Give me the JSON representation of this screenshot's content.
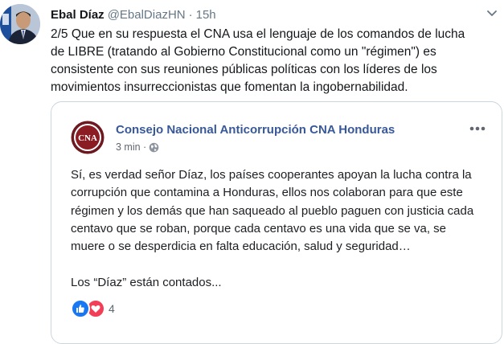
{
  "tweet": {
    "author_name": "Ebal Díaz",
    "author_handle": "@EbalDiazHN",
    "separator": "·",
    "timestamp": "15h",
    "text": "2/5 Que en su respuesta el CNA usa el lenguaje de los comandos de lucha\nde LIBRE (tratando al Gobierno Constitucional como un \"régimen\") es\nconsistente con sus reuniones públicas políticas con los líderes de los\nmovimientos insurreccionistas que fomentan la ingobernabilidad."
  },
  "facebook_post": {
    "page_name": "Consejo Nacional Anticorrupción CNA Honduras",
    "logo_text": "CNA",
    "time": "3 min ·",
    "body": "Sí, es verdad señor Díaz, los países cooperantes apoyan la lucha contra la corrupción que contamina a Honduras, ellos nos colaboran para que este régimen y los demás que han saqueado al pueblo paguen con justicia cada centavo que se roban, porque cada centavo es una vida que se va, se muere o se desperdicia en falta educación, salud y seguridad…",
    "closing": "Los “Díaz” están contados...",
    "reaction_count": "4"
  },
  "colors": {
    "link_blue": "#385898",
    "muted_gray": "#657786",
    "like_blue": "#1877f2",
    "love_red": "#f33e58",
    "cna_maroon": "#8b1c24"
  },
  "icons": [
    "profile-avatar",
    "chevron-down-icon",
    "cna-logo",
    "globe-icon",
    "more-options-icon",
    "like-reaction-icon",
    "love-reaction-icon"
  ]
}
